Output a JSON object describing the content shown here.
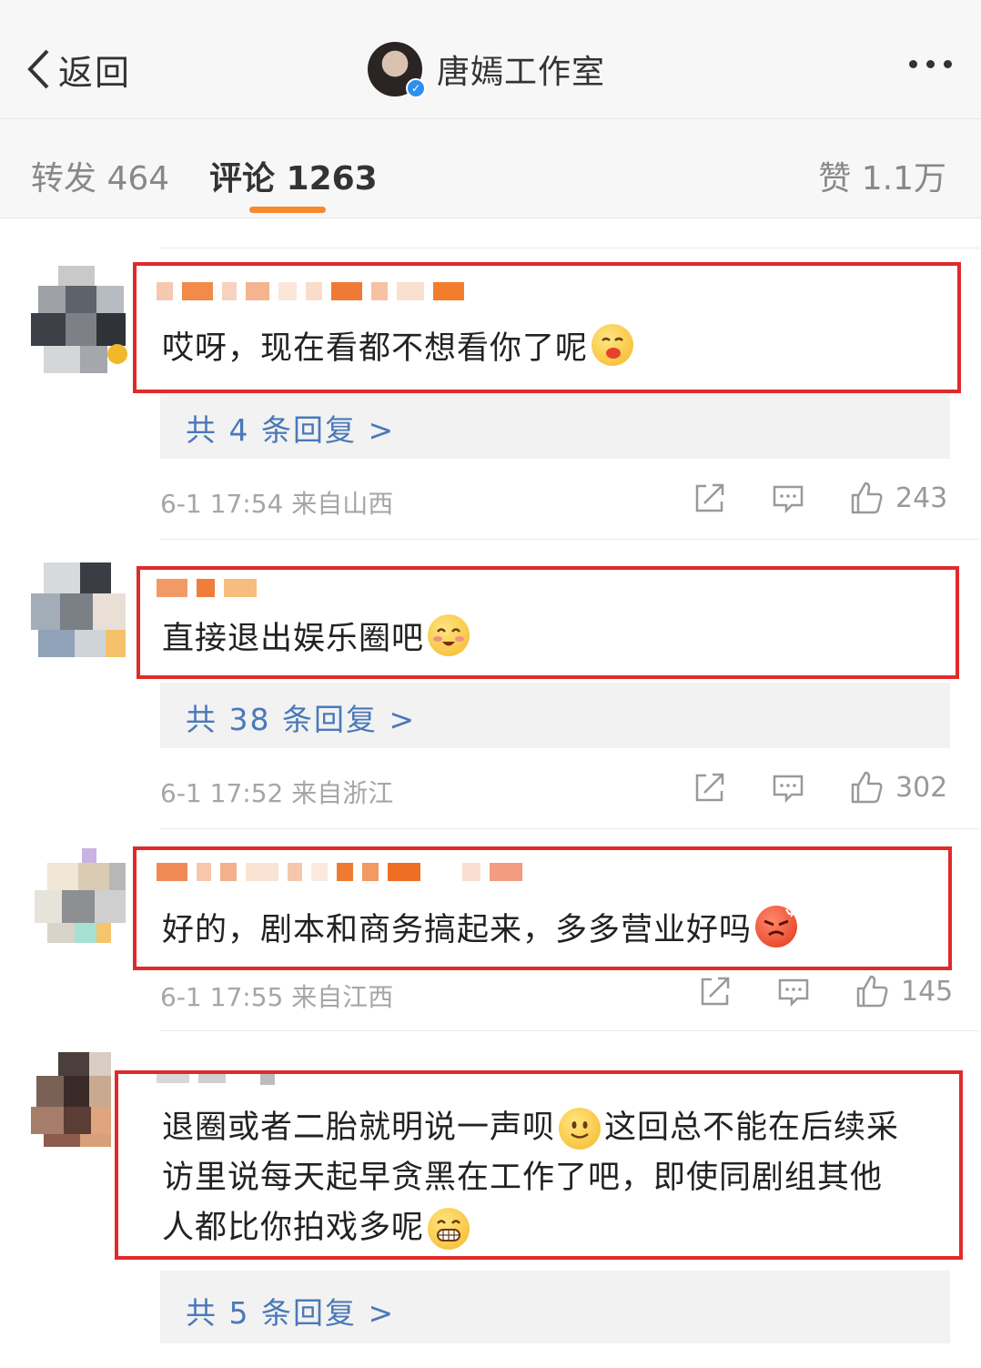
{
  "header": {
    "back_label": "返回",
    "account_name": "唐嫣工作室",
    "more_icon": "ellipsis-icon"
  },
  "tabs": {
    "repost": "转发 464",
    "comment": "评论 1263",
    "like": "赞 1.1万"
  },
  "comments": [
    {
      "text": "哎呀，现在看都不想看你了呢",
      "emoji": "yum-emoji-icon",
      "replies": "共 4 条回复 >",
      "time_location": "6-1 17:54  来自山西",
      "likes": "243"
    },
    {
      "text": "直接退出娱乐圈吧",
      "emoji": "blush-emoji-icon",
      "replies": "共 38 条回复 >",
      "time_location": "6-1 17:52  来自浙江",
      "likes": "302"
    },
    {
      "text": "好的，剧本和商务搞起来，多多营业好吗",
      "emoji": "angry-emoji-icon",
      "time_location": "6-1 17:55  来自江西",
      "likes": "145"
    },
    {
      "text_lines": [
        "退圈或者二胎就明说一声呗",
        "这回总不能在后续采",
        "访里说每天起早贪黑在工作了吧，即使同剧组其他",
        "人都比你拍戏多呢"
      ],
      "replies": "共 5 条回复 >"
    }
  ],
  "colors": {
    "highlight_box": "#e02a2a",
    "tab_indicator": "#f68a2d",
    "reply_link": "#4a79b8"
  }
}
